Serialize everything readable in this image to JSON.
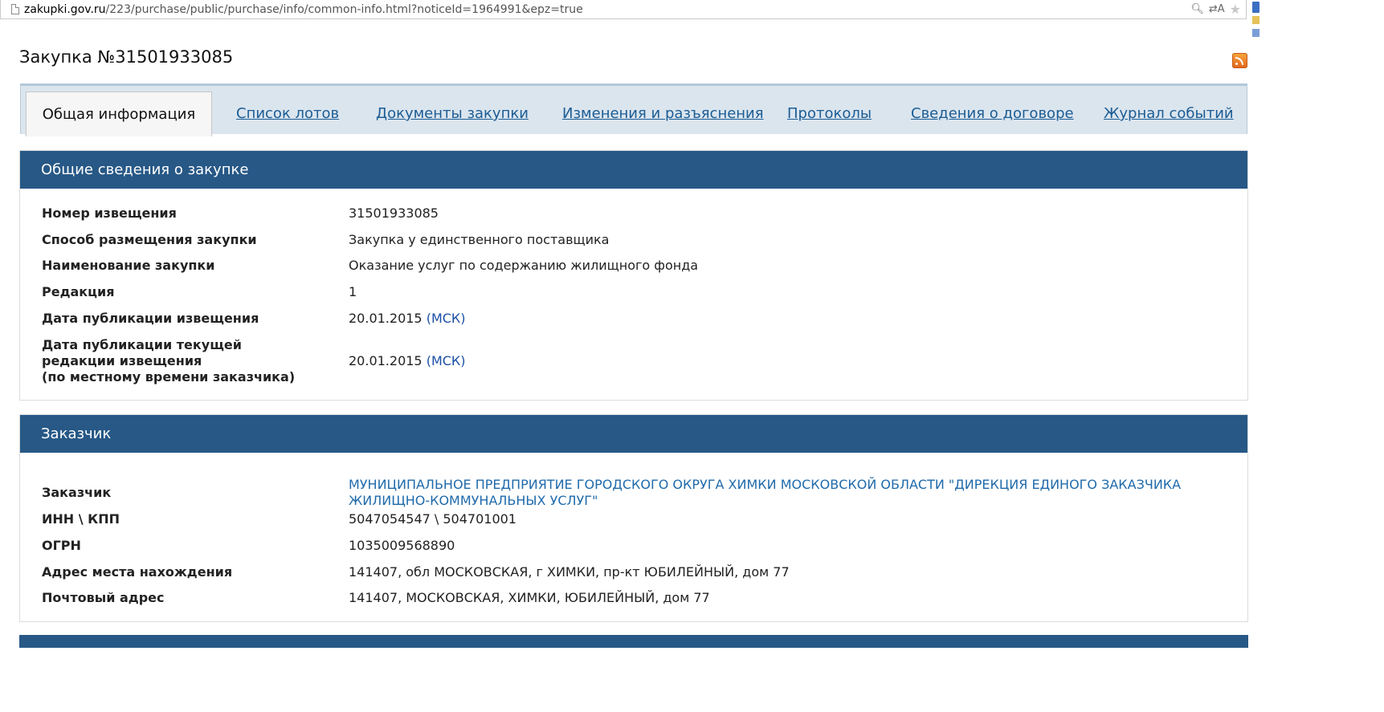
{
  "browser": {
    "url_domain": "zakupki.gov.ru",
    "url_path": "/223/purchase/public/purchase/info/common-info.html?noticeId=1964991&epz=true"
  },
  "page": {
    "title": "Закупка №31501933085"
  },
  "tabs": [
    {
      "label": "Общая информация",
      "active": true
    },
    {
      "label": "Список лотов"
    },
    {
      "label": "Документы закупки"
    },
    {
      "label": "Изменения и разъяснения"
    },
    {
      "label": "Протоколы"
    },
    {
      "label": "Сведения о договоре"
    },
    {
      "label": "Журнал событий"
    }
  ],
  "general": {
    "heading": "Общие сведения о закупке",
    "rows": [
      {
        "label": "Номер извещения",
        "value": "31501933085"
      },
      {
        "label": "Способ размещения закупки",
        "value": "Закупка у единственного поставщика"
      },
      {
        "label": "Наименование закупки",
        "value": "Оказание услуг по содержанию жилищного фонда"
      },
      {
        "label": "Редакция",
        "value": "1"
      },
      {
        "label": "Дата публикации извещения",
        "value": "20.01.2015",
        "tz": "(МСК)"
      },
      {
        "label": "Дата публикации текущей редакции извещения",
        "label2": "(по местному времени заказчика)",
        "value": "20.01.2015",
        "tz": "(МСК)"
      }
    ]
  },
  "customer": {
    "heading": "Заказчик",
    "rows": [
      {
        "label": "Заказчик",
        "value": "МУНИЦИПАЛЬНОЕ ПРЕДПРИЯТИЕ ГОРОДСКОГО ОКРУГА ХИМКИ МОСКОВСКОЙ ОБЛАСТИ \"ДИРЕКЦИЯ ЕДИНОГО ЗАКАЗЧИКА ЖИЛИЩНО-КОММУНАЛЬНЫХ УСЛУГ\""
      },
      {
        "label": "ИНН \\ КПП",
        "value": "5047054547 \\ 504701001"
      },
      {
        "label": "ОГРН",
        "value": "1035009568890"
      },
      {
        "label": "Адрес места нахождения",
        "value": "141407, обл МОСКОВСКАЯ, г ХИМКИ, пр-кт ЮБИЛЕЙНЫЙ, дом 77"
      },
      {
        "label": "Почтовый адрес",
        "value": "141407, МОСКОВСКАЯ, ХИМКИ, ЮБИЛЕЙНЫЙ, дом 77"
      }
    ]
  }
}
